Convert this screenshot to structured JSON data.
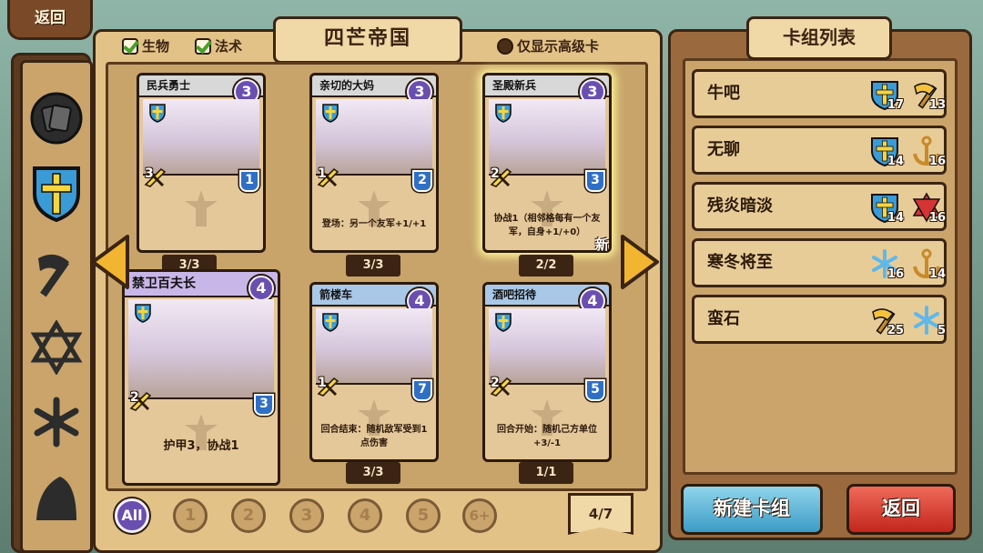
{
  "top": {
    "back_label": "返回"
  },
  "filters": {
    "creature": "生物",
    "spell": "法术",
    "premium": "仅显示高级卡"
  },
  "faction_title": "四芒帝国",
  "categories": [
    "card-back",
    "holy-shield",
    "axe",
    "hexagram",
    "snowflake",
    "dark-hood"
  ],
  "cards": [
    {
      "name": "民兵勇士",
      "cost": "3",
      "attack": "3",
      "health": "1",
      "text": "",
      "count": "3/3",
      "name_style": "grey"
    },
    {
      "name": "亲切的大妈",
      "cost": "3",
      "attack": "1",
      "health": "2",
      "text": "登场：另一个友军+1/+1",
      "count": "3/3",
      "name_style": "grey"
    },
    {
      "name": "圣殿新兵",
      "cost": "3",
      "attack": "2",
      "health": "3",
      "text": "协战1（相邻格每有一个友军，自身+1/+0）",
      "count": "2/2",
      "name_style": "grey",
      "tag": "新"
    },
    {
      "name": "禁卫百夫长",
      "cost": "4",
      "attack": "2",
      "health": "3",
      "text": "护甲3，协战1",
      "count": "",
      "name_style": "purple"
    },
    {
      "name": "箭楼车",
      "cost": "4",
      "attack": "1",
      "health": "7",
      "text": "回合结束：随机敌军受到1点伤害",
      "count": "3/3",
      "name_style": "blue"
    },
    {
      "name": "酒吧招待",
      "cost": "4",
      "attack": "2",
      "health": "5",
      "text": "回合开始：随机己方单位+3/-1",
      "count": "1/1",
      "name_style": "blue"
    }
  ],
  "cost_filters": [
    "All",
    "1",
    "2",
    "3",
    "4",
    "5",
    "6+"
  ],
  "page": "4/7",
  "deck_panel": {
    "title": "卡组列表",
    "decks": [
      {
        "name": "牛吧",
        "icons": [
          {
            "type": "holy-shield",
            "count": "17"
          },
          {
            "type": "axe",
            "count": "13"
          }
        ]
      },
      {
        "name": "无聊",
        "icons": [
          {
            "type": "holy-shield",
            "count": "14"
          },
          {
            "type": "anchor",
            "count": "16"
          }
        ]
      },
      {
        "name": "残炎暗淡",
        "icons": [
          {
            "type": "holy-shield",
            "count": "14"
          },
          {
            "type": "hexagram",
            "count": "16"
          }
        ]
      },
      {
        "name": "寒冬将至",
        "icons": [
          {
            "type": "snowflake",
            "count": "16"
          },
          {
            "type": "anchor",
            "count": "14"
          }
        ]
      },
      {
        "name": "蛮石",
        "icons": [
          {
            "type": "axe",
            "count": "25"
          },
          {
            "type": "snowflake",
            "count": "5"
          }
        ]
      }
    ],
    "new_deck_label": "新建卡组",
    "back_label": "返回"
  },
  "colors": {
    "wood": "#8a5a34",
    "parchment": "#e2c287",
    "outline": "#3b2413",
    "cost_purple": "#6a4fb0",
    "health_blue": "#2f6fc6",
    "new_btn": "#3c9cc6",
    "back_btn": "#c3261c"
  }
}
